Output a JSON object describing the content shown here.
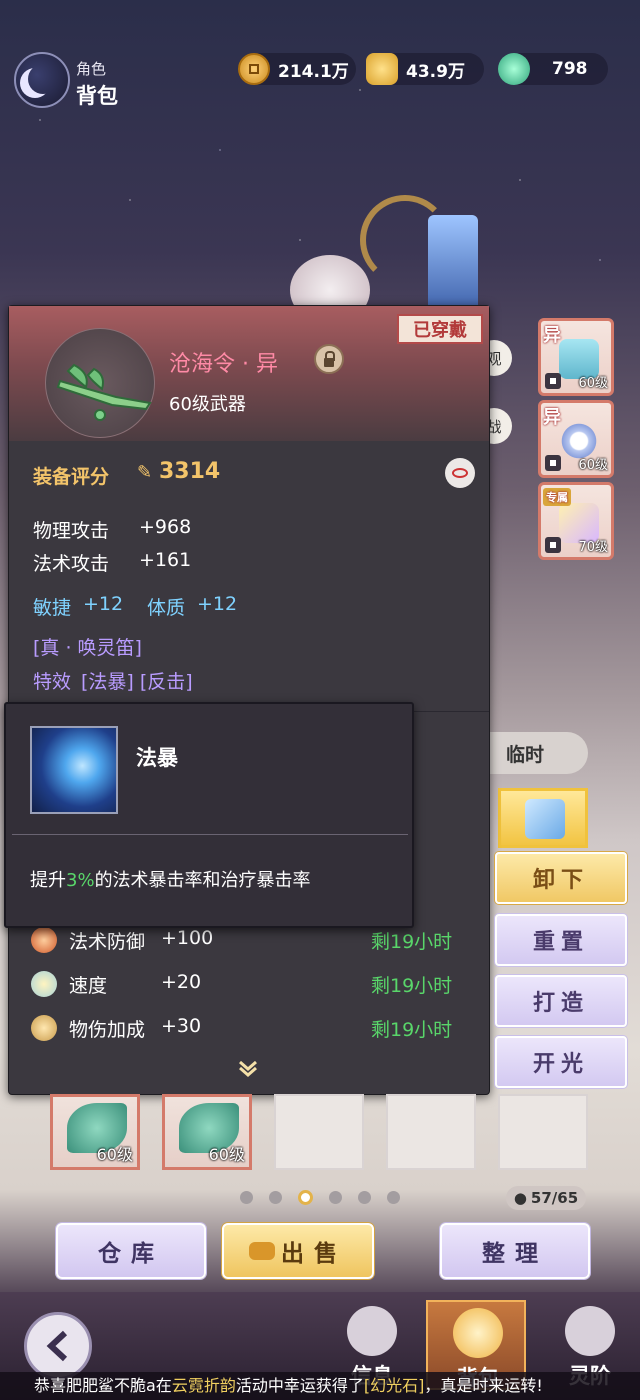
{
  "header": {
    "subtitle": "角色",
    "title": "背包"
  },
  "currencies": [
    {
      "icon": "copper-coin-icon",
      "value": "214.1万"
    },
    {
      "icon": "gold-ingot-icon",
      "value": "43.9万"
    },
    {
      "icon": "jade-dragon-icon",
      "value": "798"
    }
  ],
  "side_buttons": {
    "view": "观",
    "battle": "战"
  },
  "equip_slots": [
    {
      "tag": "异",
      "level": "60级"
    },
    {
      "tag": "异",
      "level": "60级"
    },
    {
      "tag": "专属",
      "level": "70级"
    }
  ],
  "item": {
    "worn_badge": "已穿戴",
    "name": "沧海令 · 异",
    "type": "60级武器",
    "score_label": "装备评分",
    "score": "3314",
    "stats": [
      {
        "name": "物理攻击",
        "value": "+968"
      },
      {
        "name": "法术攻击",
        "value": "+161"
      }
    ],
    "bonus": [
      {
        "name": "敏捷",
        "value": "+12"
      },
      {
        "name": "体质",
        "value": "+12"
      }
    ],
    "set_name": "[真 · 唤灵笛]",
    "effects_label": "特效",
    "effects": "[法暴] [反击]"
  },
  "buffs": [
    {
      "icon": "bowl-icon",
      "name": "法术防御",
      "value": "+100",
      "time": "剩19小时"
    },
    {
      "icon": "cloud-icon",
      "name": "速度",
      "value": "+20",
      "time": "剩19小时"
    },
    {
      "icon": "dumpling-icon",
      "name": "物伤加成",
      "value": "+30",
      "time": "剩19小时"
    }
  ],
  "skill_popup": {
    "title": "法暴",
    "desc_pre": "提升",
    "desc_hl": "3%",
    "desc_post": "的法术暴击率和治疗暴击率"
  },
  "tab_temp": "临时",
  "actions": {
    "unequip": "卸下",
    "reset": "重置",
    "forge": "打造",
    "enlighten": "开光"
  },
  "bag": {
    "items": [
      {
        "level": "60级"
      },
      {
        "level": "60级"
      }
    ],
    "capacity": "57/65",
    "page_dots": 6,
    "active_page": 3
  },
  "bottom_buttons": {
    "warehouse": "仓库",
    "sell": "出售",
    "arrange": "整理"
  },
  "nav": {
    "info": "信息",
    "bag": "背包",
    "spirit": "灵阶"
  },
  "ticker": {
    "pre": "恭喜肥肥鲨不脆a在",
    "event": "云霓折韵",
    "mid": "活动中幸运获得了",
    "reward": "[幻光石]",
    "post": "，真是时来运转!"
  }
}
